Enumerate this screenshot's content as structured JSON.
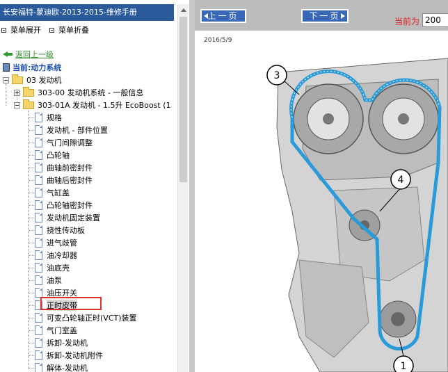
{
  "left_panel": {
    "title": "长安福特-蒙迪欧-2013-2015-维修手册",
    "menu_expand": "菜单展开",
    "menu_collapse": "菜单折叠",
    "back_link": "返回上一级",
    "current_label": "当前:动力系统",
    "tree": {
      "root": "03 发动机",
      "child1": "303-00 发动机系统 - 一般信息",
      "child2": "303-01A 发动机 - 1.5升 EcoBoost (1",
      "items": [
        "规格",
        "发动机 - 部件位置",
        "气门间隙调整",
        "凸轮轴",
        "曲轴前密封件",
        "曲轴后密封件",
        "气缸盖",
        "凸轮轴密封件",
        "发动机固定装置",
        "挠性传动板",
        "进气歧管",
        "油冷却器",
        "油底壳",
        "油泵",
        "油压开关",
        "正时皮带",
        "可变凸轮轴正时(VCT)装置",
        "气门室盖",
        "拆卸-发动机",
        "拆卸-发动机附件",
        "解体-发动机"
      ],
      "selected_index": 15
    }
  },
  "right_panel": {
    "prev_label": "上一页",
    "next_label": "下一页",
    "page_label": "当前为",
    "page_value": "200",
    "date": "2016/5/9",
    "callouts": [
      "3",
      "4",
      "1"
    ]
  },
  "colors": {
    "title_bg": "#2a5a9a",
    "button_bg": "#3a68b8",
    "belt": "#2a9ad8",
    "highlight_border": "#e03030",
    "link_green": "#2d8a2d",
    "current_blue": "#1a4fb0"
  }
}
